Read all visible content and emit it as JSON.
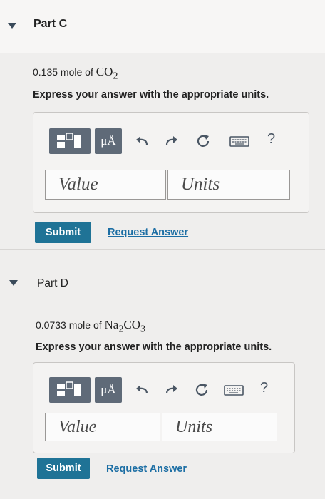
{
  "partC": {
    "title": "Part C",
    "question_prefix": "0.135 mole of ",
    "formula": "CO",
    "formula_sub": "2",
    "instruction": "Express your answer with the appropriate units.",
    "value_placeholder": "Value",
    "units_placeholder": "Units",
    "submit_label": "Submit",
    "request_label": "Request Answer"
  },
  "partD": {
    "title": "Part D",
    "question_prefix": "0.0733 mole of ",
    "formula_parts": [
      "Na",
      "2",
      "CO",
      "3"
    ],
    "instruction": "Express your answer with the appropriate units.",
    "value_placeholder": "Value",
    "units_placeholder": "Units",
    "submit_label": "Submit",
    "request_label": "Request Answer"
  },
  "toolbar": {
    "micro_angstrom_label": "μÅ",
    "help_label": "?",
    "icons": [
      "templates-icon",
      "symbols-icon",
      "undo-icon",
      "redo-icon",
      "reset-icon",
      "keyboard-icon",
      "help-icon"
    ]
  },
  "colors": {
    "toolbar_button": "#5f6a78",
    "submit_button": "#1f7396",
    "link": "#1c6ea4"
  }
}
